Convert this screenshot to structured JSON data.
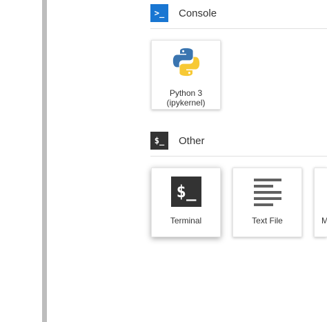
{
  "console_section": {
    "title": "Console",
    "icon": "console-icon",
    "icon_glyph": ">_",
    "color": "#1976d2"
  },
  "console_cards": [
    {
      "label_line1": "Python 3",
      "label_line2": "(ipykernel)",
      "icon": "python-logo-icon"
    }
  ],
  "other_section": {
    "title": "Other",
    "icon": "terminal-icon",
    "icon_glyph": "$_",
    "color": "#333333"
  },
  "other_cards": [
    {
      "label": "Terminal",
      "icon": "terminal-icon",
      "glyph": "$_"
    },
    {
      "label": "Text File",
      "icon": "text-file-icon"
    },
    {
      "label": "M",
      "icon": "markdown-file-icon"
    }
  ]
}
